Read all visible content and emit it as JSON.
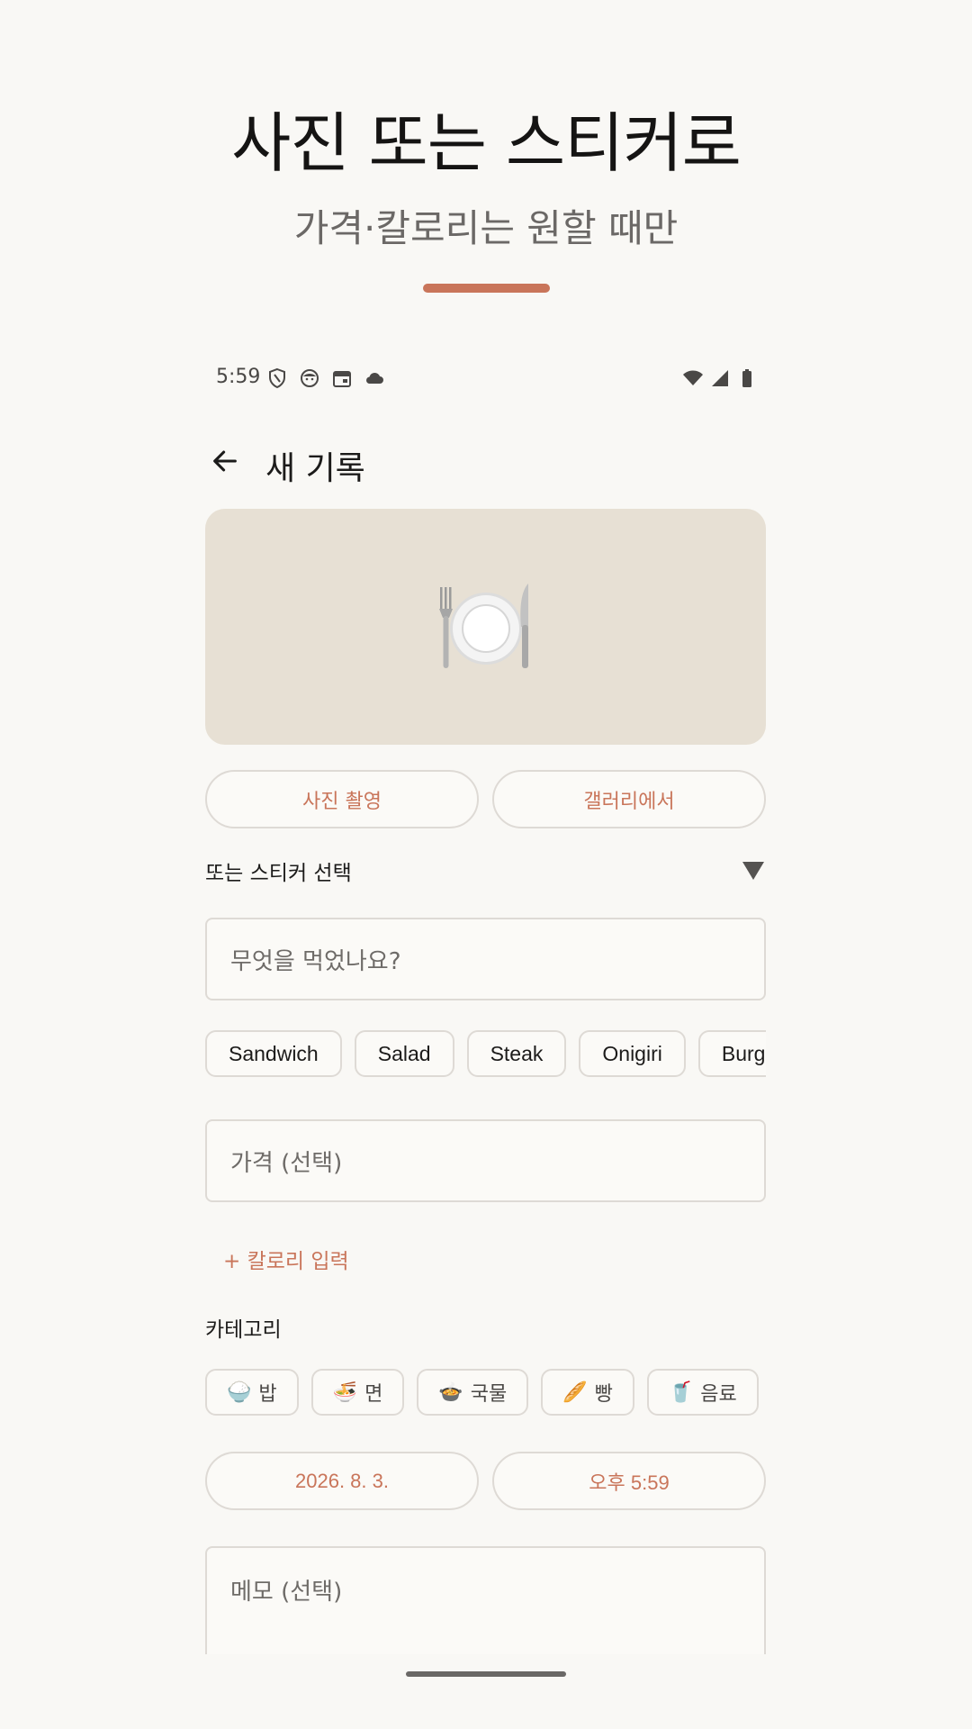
{
  "promo": {
    "title": "사진 또는 스티커로",
    "subtitle": "가격·칼로리는 원할 때만",
    "accent_color": "#c9755a"
  },
  "status_bar": {
    "time": "5:59",
    "left_icons": [
      "shield-icon",
      "face-icon",
      "calendar-icon",
      "cloud-icon"
    ],
    "right_icons": [
      "wifi-icon",
      "signal-icon",
      "battery-icon"
    ]
  },
  "header": {
    "back_icon": "arrow-back-icon",
    "title": "새 기록"
  },
  "photo": {
    "placeholder_emoji": "🍽️"
  },
  "photo_actions": {
    "camera_label": "사진 촬영",
    "gallery_label": "갤러리에서"
  },
  "sticker": {
    "label": "또는 스티커 선택",
    "expand_icon": "triangle-down-icon"
  },
  "food_input": {
    "placeholder": "무엇을 먹었나요?"
  },
  "suggestions": [
    "Sandwich",
    "Salad",
    "Steak",
    "Onigiri",
    "Burger"
  ],
  "price_input": {
    "placeholder": "가격 (선택)"
  },
  "calorie": {
    "add_label": "+ 칼로리 입력"
  },
  "category": {
    "label": "카테고리",
    "items": [
      {
        "emoji": "🍚",
        "label": "밥"
      },
      {
        "emoji": "🍜",
        "label": "면"
      },
      {
        "emoji": "🍲",
        "label": "국물"
      },
      {
        "emoji": "🥖",
        "label": "빵"
      },
      {
        "emoji": "🥤",
        "label": "음료"
      }
    ]
  },
  "datetime": {
    "date": "2026. 8. 3.",
    "time": "오후 5:59"
  },
  "memo_input": {
    "placeholder": "메모 (선택)"
  }
}
